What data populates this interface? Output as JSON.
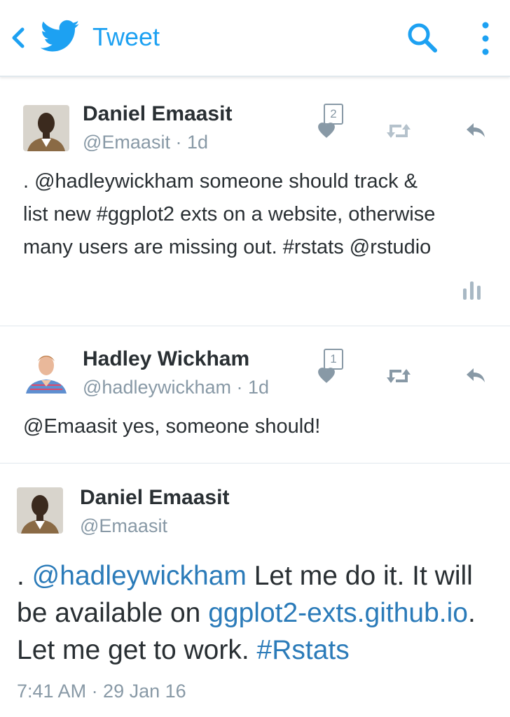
{
  "header": {
    "title": "Tweet",
    "icons": [
      "back-icon",
      "twitter-bird-icon",
      "search-icon",
      "more-icon"
    ]
  },
  "tweets": [
    {
      "name": "Daniel Emaasit",
      "handle": "@Emaasit",
      "time": "1d",
      "separator": "·",
      "text_lines": [
        ". @hadleywickham someone should track &",
        "list new #ggplot2 exts on a website, otherwise",
        "many users are missing out. #rstats @rstudio"
      ],
      "like_count": "2"
    },
    {
      "name": "Hadley Wickham",
      "handle": "@hadleywickham",
      "time": "1d",
      "separator": "·",
      "text_lines": [
        "@Emaasit yes, someone should!"
      ],
      "like_count": "1"
    }
  ],
  "focus_tweet": {
    "name": "Daniel Emaasit",
    "handle": "@Emaasit",
    "line1_prefix": ". ",
    "line1_mention": "@hadleywickham",
    "line1_rest": " Let me do it. It will",
    "line2_prefix": "be available on ",
    "line2_link": "ggplot2-exts.github.io",
    "line2_rest": ".",
    "line3_text": "Let me get to work. ",
    "line3_hashtag": "#Rstats",
    "timestamp": "7:41 AM · 29 Jan 16"
  },
  "colors": {
    "twitter_blue": "#1da1f2",
    "link_blue": "#2b7bb9",
    "gray": "#8899a6",
    "text": "#292f33"
  }
}
